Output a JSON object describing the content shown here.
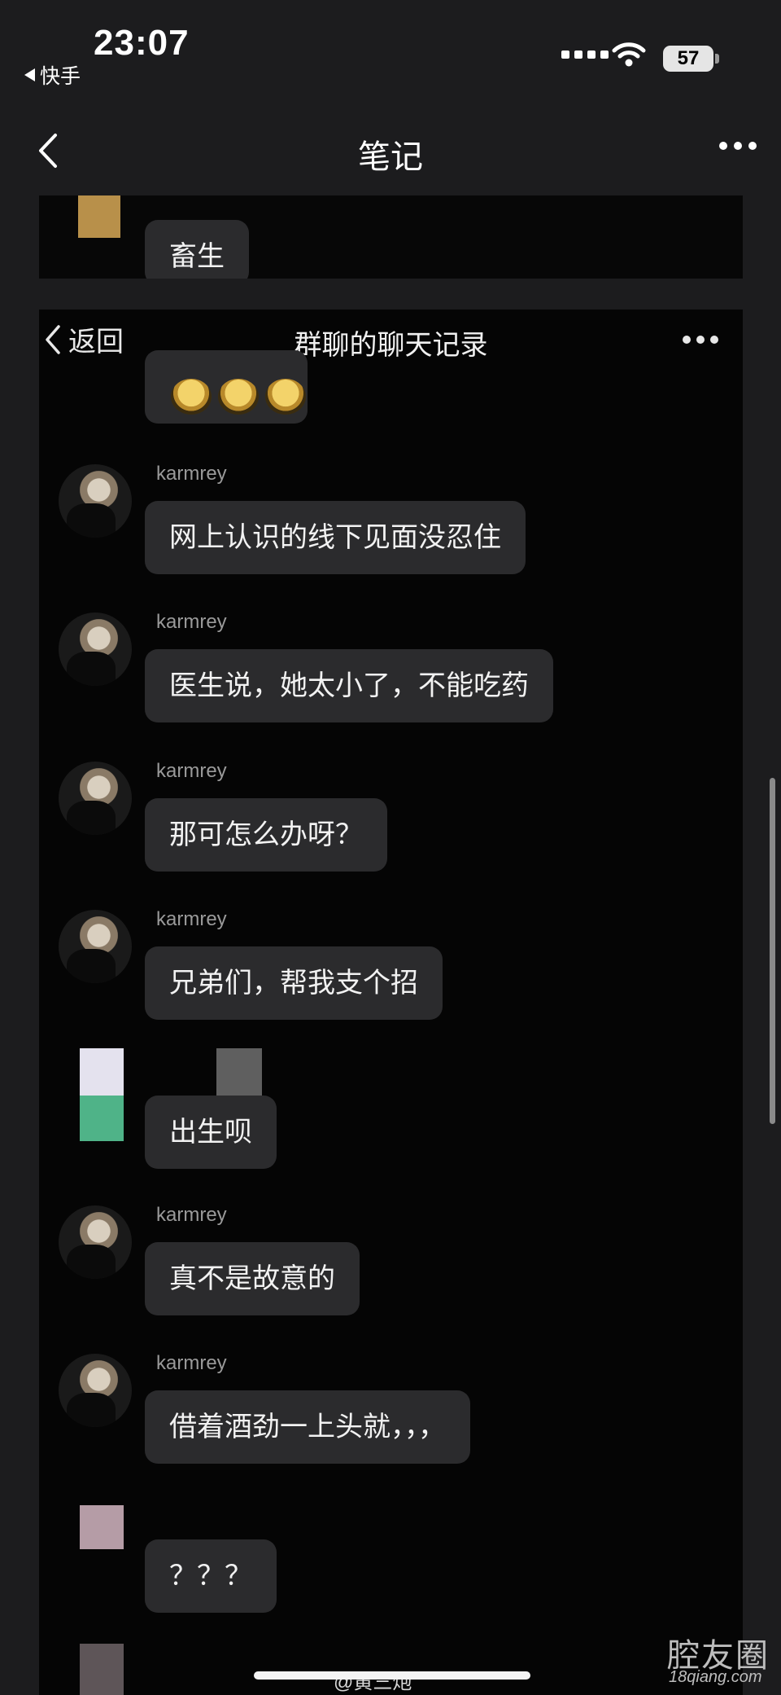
{
  "status_bar": {
    "time": "23:07",
    "back_app": "快手",
    "battery": "57"
  },
  "nav": {
    "title": "笔记"
  },
  "top_snippet": {
    "message": "畜生"
  },
  "inner_chat": {
    "back_label": "返回",
    "title": "群聊的聊天记录",
    "messages": [
      {
        "user": "karmrey",
        "text": "网上认识的线下见面没忍住"
      },
      {
        "user": "karmrey",
        "text": "医生说，她太小了，不能吃药"
      },
      {
        "user": "karmrey",
        "text": "那可怎么办呀？"
      },
      {
        "user": "karmrey",
        "text": "兄弟们，帮我支个招"
      },
      {
        "user": "",
        "text": "出生呗"
      },
      {
        "user": "karmrey",
        "text": "真不是故意的"
      },
      {
        "user": "karmrey",
        "text": "借着酒劲一上头就，，，"
      },
      {
        "user": "",
        "text": "？？？"
      }
    ]
  },
  "watermark": {
    "weibo": "@黄三炮",
    "site_name": "腔友圈",
    "site_url": "18qiang.com"
  },
  "colors": {
    "background": "#1c1c1e",
    "chat_background": "#050505",
    "bubble": "#2b2b2d",
    "username": "#9a9a9a"
  }
}
